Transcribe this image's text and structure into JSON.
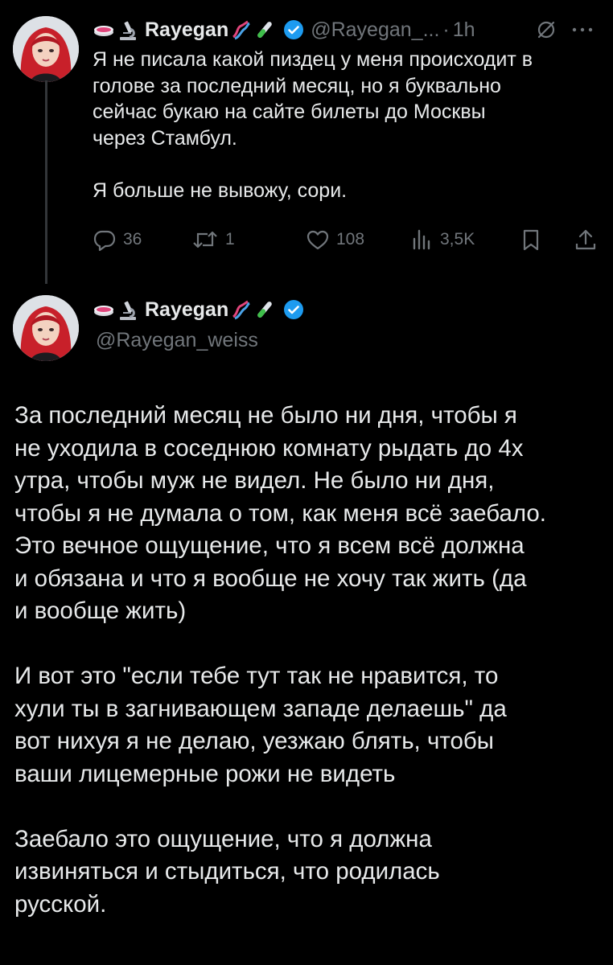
{
  "tweet1": {
    "author_name": "Rayegan",
    "handle": "@Rayegan_...",
    "time": "1h",
    "text": "Я не писала какой пиздец у меня происходит в\nголове за последний месяц, но я буквально\nсейчас букаю на сайте билеты до Москвы\nчерез Стамбул.\n\nЯ больше не вывожу, сори.",
    "stats": {
      "replies": "36",
      "reposts": "1",
      "likes": "108",
      "views": "3,5K"
    }
  },
  "tweet2": {
    "author_name": "Rayegan",
    "handle": "@Rayegan_weiss",
    "text": "За последний месяц не было ни дня, чтобы я\nне уходила в соседнюю комнату рыдать до 4х\nутра, чтобы муж не видел. Не было ни дня,\nчтобы я не думала о том, как меня всё заебало.\nЭто вечное ощущение, что я всем всё должна\nи обязана и что я вообще не хочу так жить (да\nи вообще жить)\n\nИ вот это \"если тебе тут так не нравится, то\nхули ты в загнивающем западе делаешь\" да\nвот нихуя я не делаю, уезжаю блять, чтобы\nваши лицемерные рожи не видеть\n\nЗаебало это ощущение, что я должна\nизвиняться и стыдиться, что родилась\nрусской."
  },
  "icons": {
    "name_emojis": [
      "petri-dish-icon",
      "microscope-icon",
      "dna-icon",
      "test-tube-icon"
    ],
    "verified": "verified-badge-icon",
    "actions": [
      "reply-icon",
      "repost-icon",
      "like-icon",
      "views-icon",
      "bookmark-icon",
      "share-icon"
    ]
  },
  "colors": {
    "background": "#000000",
    "text_primary": "#e7e9ea",
    "text_secondary": "#71767b",
    "verified_blue": "#1d9bf0",
    "thread_line": "#333639"
  }
}
